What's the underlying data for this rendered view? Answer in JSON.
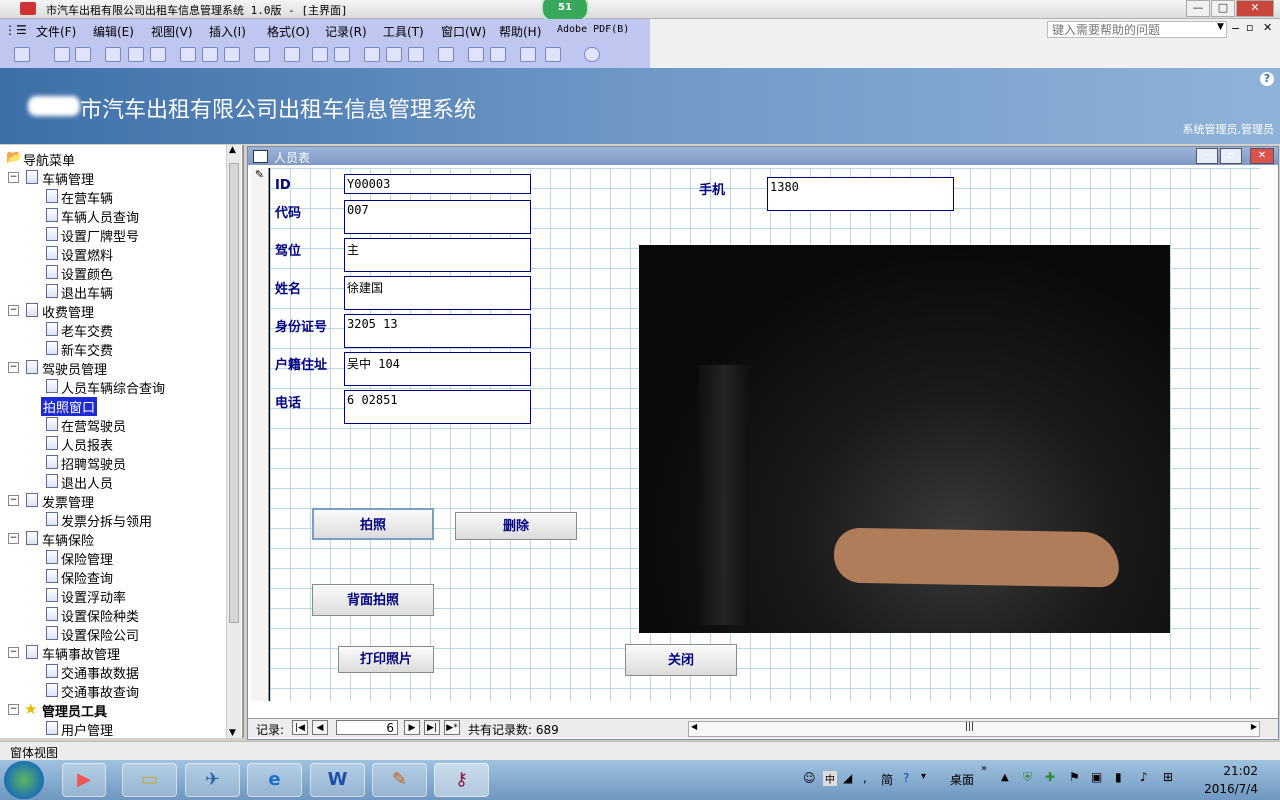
{
  "window": {
    "title": "市汽车出租有限公司出租车信息管理系统 1.0版 - [主界面]",
    "badge": "51",
    "min_label": "—",
    "max_label": "□",
    "close_label": "✕"
  },
  "menu": {
    "items": [
      "文件(F)",
      "编辑(E)",
      "视图(V)",
      "插入(I)",
      "格式(O)",
      "记录(R)",
      "工具(T)",
      "窗口(W)",
      "帮助(H)",
      "Adobe PDF(B)"
    ],
    "help_placeholder": "键入需要帮助的问题"
  },
  "banner": {
    "title": "市汽车出租有限公司出租车信息管理系统",
    "user": "系统管理员,管理员",
    "help": "?"
  },
  "nav": {
    "root": "导航菜单",
    "groups": [
      {
        "label": "车辆管理",
        "items": [
          "在营车辆",
          "车辆人员查询",
          "设置厂牌型号",
          "设置燃料",
          "设置颜色",
          "退出车辆"
        ]
      },
      {
        "label": "收费管理",
        "items": [
          "老车交费",
          "新车交费"
        ]
      },
      {
        "label": "驾驶员管理",
        "items": [
          "人员车辆综合查询",
          "拍照窗口",
          "在营驾驶员",
          "人员报表",
          "招聘驾驶员",
          "退出人员"
        ]
      },
      {
        "label": "发票管理",
        "items": [
          "发票分拆与领用"
        ]
      },
      {
        "label": "车辆保险",
        "items": [
          "保险管理",
          "保险查询",
          "设置浮动率",
          "设置保险种类",
          "设置保险公司"
        ]
      },
      {
        "label": "车辆事故管理",
        "items": [
          "交通事故数据",
          "交通事故查询"
        ]
      },
      {
        "label": "管理员工具",
        "items": [
          "用户管理"
        ]
      }
    ],
    "selected": "拍照窗口"
  },
  "form": {
    "title": "人员表",
    "fields": {
      "id": {
        "label": "ID",
        "value": "Y00003"
      },
      "code": {
        "label": "代码",
        "value": "007"
      },
      "seat": {
        "label": "驾位",
        "value": "主"
      },
      "name": {
        "label": "姓名",
        "value": "徐建国"
      },
      "idcard": {
        "label": "身份证号",
        "value": "3205                13"
      },
      "address": {
        "label": "户籍住址",
        "value": "吴中         104"
      },
      "phone": {
        "label": "电话",
        "value": "6  02851"
      },
      "mobile": {
        "label": "手机",
        "value": "1380"
      }
    },
    "buttons": {
      "take_photo": "拍照",
      "delete": "删除",
      "back_photo": "背面拍照",
      "print_photo": "打印照片",
      "close": "关闭"
    },
    "record_nav": {
      "label": "记录:",
      "current": "6",
      "total_label": "共有记录数: 689"
    }
  },
  "status": {
    "text": "窗体视图"
  },
  "taskbar": {
    "tray_desktop": "桌面",
    "time": "21:02",
    "date": "2016/7/4",
    "ime_label": "简"
  }
}
